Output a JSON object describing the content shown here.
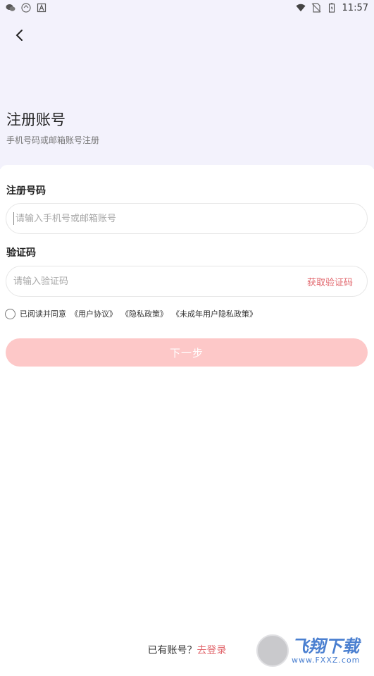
{
  "status_bar": {
    "time": "11:57",
    "left_icons": [
      "wechat-icon",
      "notification-icon",
      "app-icon"
    ],
    "right_icons": [
      "wifi-icon",
      "no-sim-icon",
      "battery-icon"
    ]
  },
  "header": {
    "title": "注册账号",
    "subtitle": "手机号码或邮箱账号注册"
  },
  "form": {
    "account_label": "注册号码",
    "account_placeholder": "请输入手机号或邮箱账号",
    "code_label": "验证码",
    "code_placeholder": "请输入验证码",
    "get_code_label": "获取验证码"
  },
  "agreement": {
    "prefix": "已阅读并同意",
    "user_agreement": "《用户协议》",
    "privacy_policy": "《隐私政策》",
    "minor_privacy_policy": "《未成年用户隐私政策》"
  },
  "next_button": "下一步",
  "footer": {
    "have_account": "已有账号？",
    "login_link": "去登录"
  },
  "watermark": {
    "big": "飞翔下载",
    "small": "www.FXXZ.com"
  },
  "colors": {
    "header_bg": "#f3f2fc",
    "accent": "#e2686e",
    "button_disabled": "#fdc8c8"
  }
}
